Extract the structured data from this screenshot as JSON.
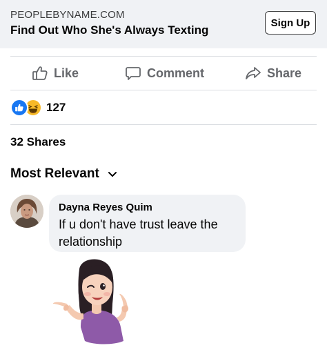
{
  "ad": {
    "domain": "PEOPLEBYNAME.COM",
    "headline": "Find Out Who She's Always Texting",
    "cta_label": "Sign Up"
  },
  "actions": {
    "like_label": "Like",
    "comment_label": "Comment",
    "share_label": "Share"
  },
  "reactions": {
    "types": [
      "like",
      "haha"
    ],
    "count": "127"
  },
  "shares_text": "32 Shares",
  "sort": {
    "label": "Most Relevant"
  },
  "comment": {
    "author": "Dayna Reyes Quim",
    "text_line1": "If u don't have trust leave the",
    "text_line2": "relationship",
    "sticker": "woman-pointing-sticker"
  },
  "colors": {
    "like_blue": "#1877f2",
    "haha_yellow": "#f7b928",
    "secondary_text": "#65676b",
    "bubble_bg": "#f0f2f5"
  }
}
